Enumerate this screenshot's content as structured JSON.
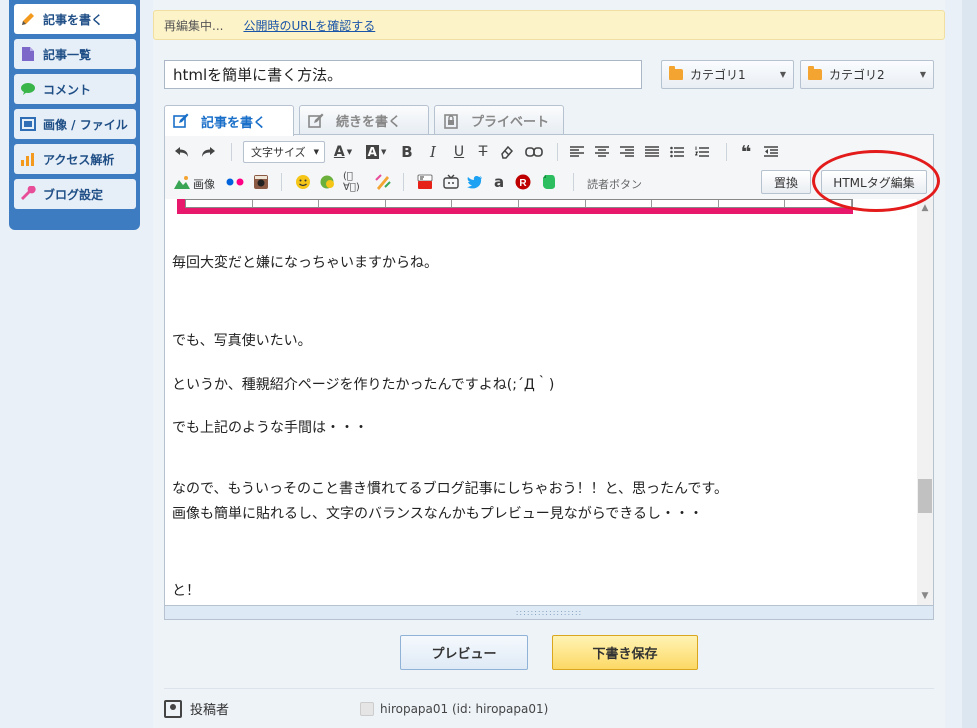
{
  "sidebar": {
    "items": [
      {
        "label": "記事を書く",
        "icon": "pencil-icon"
      },
      {
        "label": "記事一覧",
        "icon": "document-icon"
      },
      {
        "label": "コメント",
        "icon": "speech-bubble-icon"
      },
      {
        "label": "画像 / ファイル",
        "icon": "image-icon"
      },
      {
        "label": "アクセス解析",
        "icon": "bar-chart-icon"
      },
      {
        "label": "ブログ設定",
        "icon": "wrench-icon"
      }
    ]
  },
  "notice": {
    "status": "再編集中...",
    "link": "公開時のURLを確認する"
  },
  "post": {
    "title": "htmlを簡単に書く方法。",
    "category1": "カテゴリ1",
    "category2": "カテゴリ2"
  },
  "tabs": [
    {
      "label": "記事を書く"
    },
    {
      "label": "続きを書く"
    },
    {
      "label": "プライベート"
    }
  ],
  "toolbar": {
    "font_size": "文字サイズ",
    "image_label": "画像",
    "reader_button": "読者ボタン",
    "replace": "置換",
    "html_edit": "HTMLタグ編集",
    "emoji_kaomoji": "(ﾟ∀ﾟ)"
  },
  "content": {
    "lines": [
      "毎回大変だと嫌になっちゃいますからね。",
      "でも、写真使いたい。",
      "というか、種親紹介ページを作りたかったんですよね(;´Д｀)",
      "でも上記のような手間は・・・",
      "なので、もういっそのこと書き慣れてるブログ記事にしちゃおう！！と、思ったんです。",
      "画像も簡単に貼れるし、文字のバランスなんかもプレビュー見ながらできるし・・・",
      "と！"
    ]
  },
  "buttons": {
    "preview": "プレビュー",
    "save_draft": "下書き保存"
  },
  "author": {
    "label": "投稿者",
    "name": "hiropapa01 (id: hiropapa01)"
  },
  "colors": {
    "sidebar_bg": "#3d7cc0",
    "accent_blue": "#1a6fc9",
    "notice_bg": "#fdf3c8",
    "annotation_red": "#e31b1b",
    "pink_table": "#e8196c"
  }
}
